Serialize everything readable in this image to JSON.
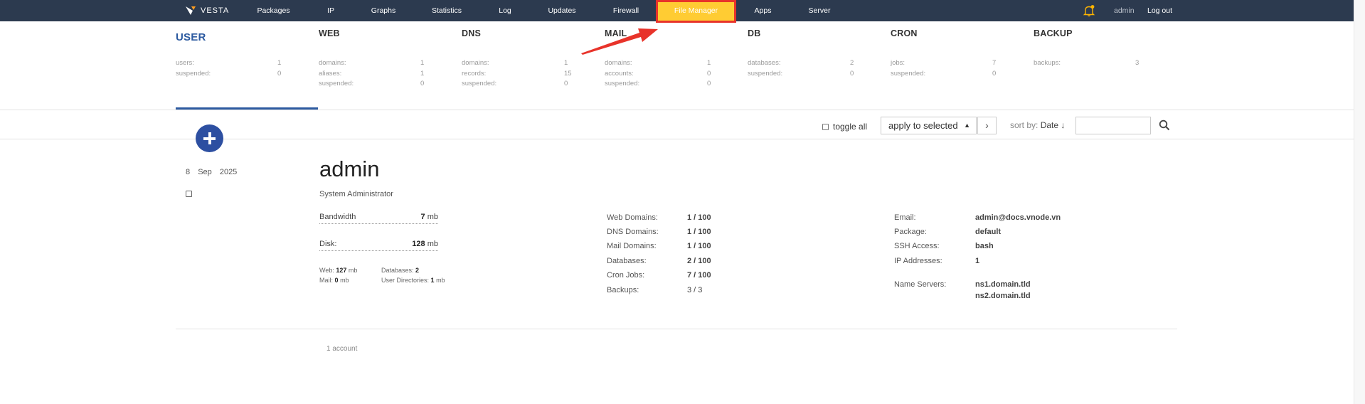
{
  "brand": {
    "name": "VESTA"
  },
  "nav": {
    "items": [
      {
        "label": "Packages"
      },
      {
        "label": "IP"
      },
      {
        "label": "Graphs"
      },
      {
        "label": "Statistics"
      },
      {
        "label": "Log"
      },
      {
        "label": "Updates"
      },
      {
        "label": "Firewall"
      },
      {
        "label": "File Manager"
      },
      {
        "label": "Apps"
      },
      {
        "label": "Server"
      }
    ],
    "user": "admin",
    "logout": "Log out"
  },
  "stats": {
    "user": {
      "title": "USER",
      "rows": [
        {
          "k": "users:",
          "v": "1"
        },
        {
          "k": "suspended:",
          "v": "0"
        }
      ]
    },
    "web": {
      "title": "WEB",
      "rows": [
        {
          "k": "domains:",
          "v": "1"
        },
        {
          "k": "aliases:",
          "v": "1"
        },
        {
          "k": "suspended:",
          "v": "0"
        }
      ]
    },
    "dns": {
      "title": "DNS",
      "rows": [
        {
          "k": "domains:",
          "v": "1"
        },
        {
          "k": "records:",
          "v": "15"
        },
        {
          "k": "suspended:",
          "v": "0"
        }
      ]
    },
    "mail": {
      "title": "MAIL",
      "rows": [
        {
          "k": "domains:",
          "v": "1"
        },
        {
          "k": "accounts:",
          "v": "0"
        },
        {
          "k": "suspended:",
          "v": "0"
        }
      ]
    },
    "db": {
      "title": "DB",
      "rows": [
        {
          "k": "databases:",
          "v": "2"
        },
        {
          "k": "suspended:",
          "v": "0"
        }
      ]
    },
    "cron": {
      "title": "CRON",
      "rows": [
        {
          "k": "jobs:",
          "v": "7"
        },
        {
          "k": "suspended:",
          "v": "0"
        }
      ]
    },
    "backup": {
      "title": "BACKUP",
      "rows": [
        {
          "k": "backups:",
          "v": "3"
        }
      ]
    }
  },
  "toolbar": {
    "toggle_all": "toggle all",
    "apply_selected": "apply to selected",
    "sort_label": "sort by:",
    "sort_value": "Date ↓",
    "search_value": ""
  },
  "record": {
    "date": {
      "day": "8",
      "month": "Sep",
      "year": "2025"
    },
    "name": "admin",
    "role": "System Administrator",
    "bandwidth": {
      "label": "Bandwidth",
      "value": "7",
      "unit": "mb"
    },
    "disk": {
      "label": "Disk:",
      "value": "128",
      "unit": "mb"
    },
    "usage": {
      "web": {
        "label": "Web:",
        "value": "127",
        "unit": "mb"
      },
      "mail": {
        "label": "Mail:",
        "value": "0",
        "unit": "mb"
      },
      "databases": {
        "label": "Databases:",
        "value": "2"
      },
      "user_dirs": {
        "label": "User Directories:",
        "value": "1",
        "unit": "mb"
      }
    },
    "limits": [
      {
        "k": "Web Domains:",
        "v": "1 / 100"
      },
      {
        "k": "DNS Domains:",
        "v": "1 / 100"
      },
      {
        "k": "Mail Domains:",
        "v": "1 / 100"
      },
      {
        "k": "Databases:",
        "v": "2 / 100"
      },
      {
        "k": "Cron Jobs:",
        "v": "7 / 100"
      },
      {
        "k": "Backups:",
        "v": "3 / 3"
      }
    ],
    "info": [
      {
        "k": "Email:",
        "v": "admin@docs.vnode.vn"
      },
      {
        "k": "Package:",
        "v": "default"
      },
      {
        "k": "SSH Access:",
        "v": "bash"
      },
      {
        "k": "IP Addresses:",
        "v": "1"
      }
    ],
    "name_servers": {
      "k": "Name Servers:",
      "v1": "ns1.domain.tld",
      "v2": "ns2.domain.tld"
    }
  },
  "footer": {
    "count": "1 account"
  },
  "colors": {
    "nav_bg": "#2c3a4f",
    "accent": "#2c5aa0",
    "highlight": "#ffcc33",
    "annotation": "#e8332a"
  }
}
